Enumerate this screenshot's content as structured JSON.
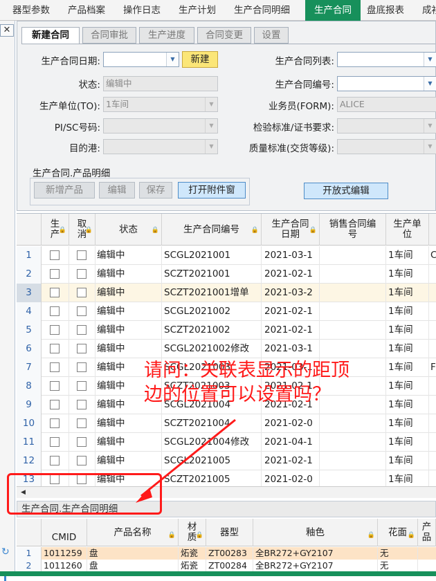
{
  "menu": {
    "items": [
      "器型参数",
      "产品档案",
      "操作日志",
      "生产计划",
      "生产合同明细",
      "生产合同",
      "盘底报表",
      "成衫"
    ],
    "active": "生产合同",
    "accent": "#17905b"
  },
  "tabs": [
    "新建合同",
    "合同审批",
    "生产进度",
    "合同变更",
    "设置"
  ],
  "form": {
    "contract_date_label": "生产合同日期:",
    "contract_date_value": "",
    "new_button": "新建",
    "contract_list_label": "生产合同列表:",
    "contract_list_value": "",
    "status_label": "状态:",
    "status_value": "编辑中",
    "contract_no_label": "生产合同编号:",
    "contract_no_value": "",
    "unit_label": "生产单位(TO):",
    "unit_value": "1车间",
    "salesman_label": "业务员(FORM):",
    "salesman_value": "ALICE",
    "pisc_label": "PI/SC号码:",
    "pisc_value": "",
    "inspection_label": "检验标准/证书要求:",
    "inspection_value": "",
    "port_label": "目的港:",
    "port_value": "",
    "quality_label": "质量标准(交货等级):",
    "quality_value": "",
    "detail_group_label": "生产合同.产品明细",
    "add_product_button": "新增产品",
    "edit_button": "编辑",
    "save_button": "保存",
    "attach_button": "打开附件窗",
    "open_edit_button": "开放式编辑"
  },
  "grid": {
    "headers": {
      "produce": "生产",
      "cancel": "取消",
      "status": "状态",
      "contract_no": "生产合同编号",
      "contract_date": "生产合同日期",
      "sales_no": "销售合同编号",
      "unit": "生产单位"
    },
    "rows": [
      {
        "n": "1",
        "status": "编辑中",
        "no": "SCGL2021001",
        "date": "2021-03-1",
        "unit": "1车间",
        "extra": "C"
      },
      {
        "n": "2",
        "status": "编辑中",
        "no": "SCZT2021001",
        "date": "2021-02-1",
        "unit": "1车间",
        "extra": ""
      },
      {
        "n": "3",
        "status": "编辑中",
        "no": "SCZT2021001增单",
        "date": "2021-03-2",
        "unit": "1车间",
        "extra": ""
      },
      {
        "n": "4",
        "status": "编辑中",
        "no": "SCGL2021002",
        "date": "2021-02-1",
        "unit": "1车间",
        "extra": ""
      },
      {
        "n": "5",
        "status": "编辑中",
        "no": "SCZT2021002",
        "date": "2021-02-1",
        "unit": "1车间",
        "extra": ""
      },
      {
        "n": "6",
        "status": "编辑中",
        "no": "SCGL2021002修改",
        "date": "2021-03-1",
        "unit": "1车间",
        "extra": ""
      },
      {
        "n": "7",
        "status": "编辑中",
        "no": "SCGL2021003",
        "date": "2021-03-1",
        "unit": "1车间",
        "extra": "F"
      },
      {
        "n": "8",
        "status": "编辑中",
        "no": "SCZT2021003",
        "date": "2021-02-1",
        "unit": "1车间",
        "extra": ""
      },
      {
        "n": "9",
        "status": "编辑中",
        "no": "SCGL2021004",
        "date": "2021-02-1",
        "unit": "1车间",
        "extra": ""
      },
      {
        "n": "10",
        "status": "编辑中",
        "no": "SCZT2021004",
        "date": "2021-02-0",
        "unit": "1车间",
        "extra": ""
      },
      {
        "n": "11",
        "status": "编辑中",
        "no": "SCGL2021004修改",
        "date": "2021-04-1",
        "unit": "1车间",
        "extra": ""
      },
      {
        "n": "12",
        "status": "编辑中",
        "no": "SCGL2021005",
        "date": "2021-02-1",
        "unit": "1车间",
        "extra": ""
      },
      {
        "n": "13",
        "status": "编辑中",
        "no": "SCZT2021005",
        "date": "2021-02-0",
        "unit": "1车间",
        "extra": ""
      }
    ],
    "selected_row": "3"
  },
  "subgrid": {
    "title": "生产合同.生产合同明细",
    "headers": {
      "cmid": "CMID",
      "product_name": "产品名称",
      "material": "材质",
      "shape": "器型",
      "glaze": "釉色",
      "decor": "花面",
      "more": "产品"
    },
    "rows": [
      {
        "n": "1",
        "cmid": "1011259",
        "name": "盘",
        "material": "炻瓷",
        "shape": "ZT00283",
        "glaze": "全BR272+GY2107",
        "decor": "无"
      },
      {
        "n": "2",
        "cmid": "1011260",
        "name": "盘",
        "material": "炻瓷",
        "shape": "ZT00284",
        "glaze": "全BR272+GY2107",
        "decor": "无"
      }
    ]
  },
  "annotation": {
    "line1": "请问：关联表显示的距顶",
    "line2": "边的位置可以设置吗？",
    "color": "#ff1a1a"
  }
}
